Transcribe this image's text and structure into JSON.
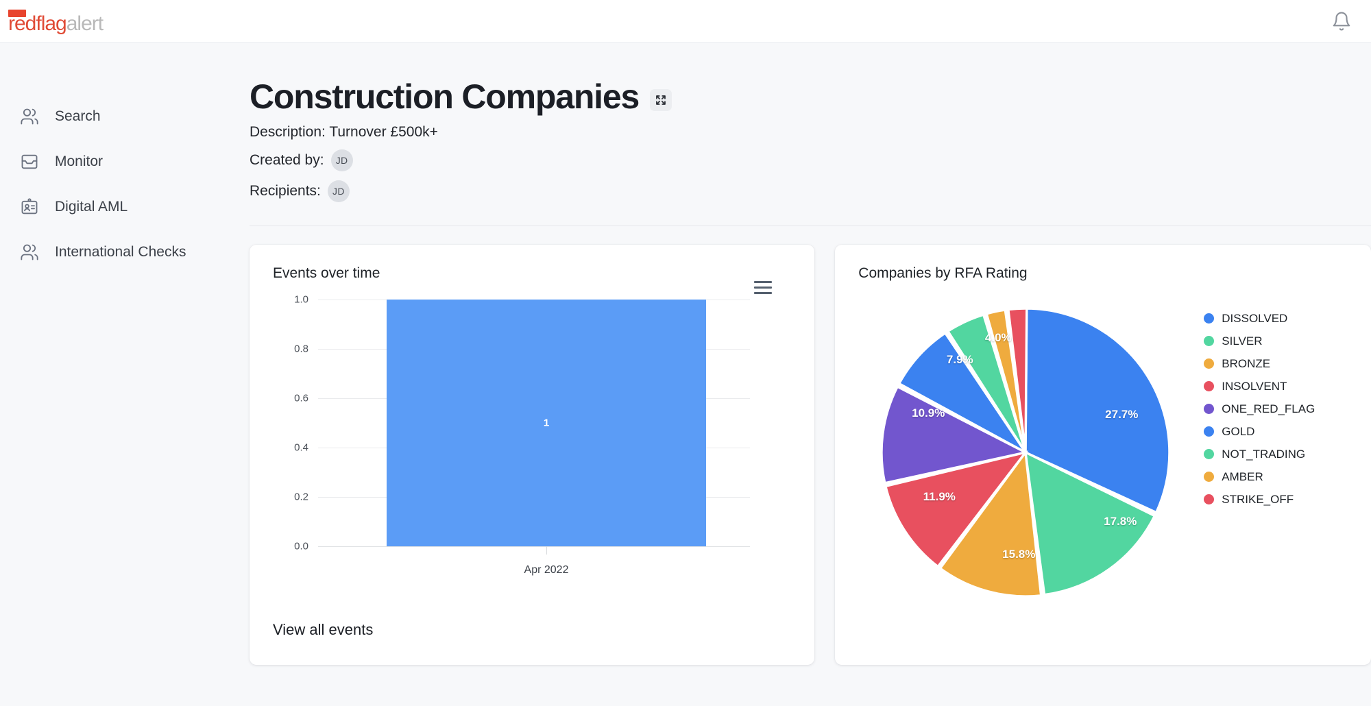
{
  "brand": {
    "name_red": "redflag",
    "name_gray": "alert"
  },
  "topbar": {
    "notifications_icon": "bell-icon"
  },
  "sidebar": {
    "items": [
      {
        "label": "Search",
        "icon": "users-icon"
      },
      {
        "label": "Monitor",
        "icon": "inbox-icon"
      },
      {
        "label": "Digital AML",
        "icon": "id-badge-icon"
      },
      {
        "label": "International Checks",
        "icon": "users-icon"
      }
    ]
  },
  "page": {
    "title": "Construction Companies",
    "expand_icon": "expand-icon",
    "description_label": "Description:",
    "description_value": "Turnover £500k+",
    "description_line": "Description: Turnover £500k+",
    "created_by_label": "Created by:",
    "created_by_avatar": "JD",
    "recipients_label": "Recipients:",
    "recipients_avatar": "JD"
  },
  "events_card": {
    "title": "Events over time",
    "menu_icon": "hamburger-menu-icon",
    "view_all_label": "View all events"
  },
  "rating_card": {
    "title": "Companies by RFA Rating"
  },
  "chart_data": [
    {
      "type": "bar",
      "title": "Events over time",
      "categories": [
        "Apr 2022"
      ],
      "values": [
        1
      ],
      "data_labels": [
        "1"
      ],
      "xlabel": "",
      "ylabel": "",
      "ylim": [
        0,
        1
      ],
      "yticks": [
        "0.0",
        "0.2",
        "0.4",
        "0.6",
        "0.8",
        "1.0"
      ],
      "grid": true,
      "legend": "none",
      "series_color": "#5b9cf6"
    },
    {
      "type": "pie",
      "title": "Companies by RFA Rating",
      "legend_position": "right",
      "labels": [
        "DISSOLVED",
        "SILVER",
        "BRONZE",
        "INSOLVENT",
        "ONE_RED_FLAG",
        "GOLD",
        "NOT_TRADING",
        "AMBER",
        "STRIKE_OFF"
      ],
      "values": [
        27.7,
        17.8,
        15.8,
        11.9,
        10.9,
        7.9,
        4.0,
        2.0,
        2.0
      ],
      "data_labels": [
        "27.7%",
        "17.8%",
        "15.8%",
        "11.9%",
        "10.9%",
        "7.9%",
        "4.0%",
        "",
        ""
      ],
      "colors": [
        "#3b82f0",
        "#52d6a0",
        "#efab3e",
        "#e8505f",
        "#7256ce",
        "#3b82f0",
        "#52d6a0",
        "#efab3e",
        "#e8505f"
      ]
    }
  ]
}
